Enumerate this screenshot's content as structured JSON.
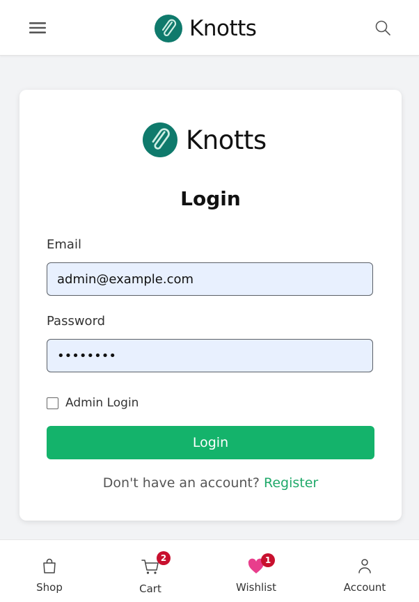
{
  "header": {
    "brand_name": "Knotts",
    "menu_icon": "hamburger-menu-icon",
    "search_icon": "search-icon"
  },
  "login_card": {
    "brand_name": "Knotts",
    "title": "Login",
    "email": {
      "label": "Email",
      "value": "admin@example.com"
    },
    "password": {
      "label": "Password",
      "value": "••••••••"
    },
    "admin_checkbox": {
      "label": "Admin Login",
      "checked": false
    },
    "submit_label": "Login",
    "register_prompt": "Don't have an account?",
    "register_link": "Register"
  },
  "bottom_nav": {
    "items": [
      {
        "label": "Shop",
        "icon": "shopping-bag-icon"
      },
      {
        "label": "Cart",
        "icon": "cart-icon",
        "badge": "2"
      },
      {
        "label": "Wishlist",
        "icon": "heart-icon",
        "badge": "1"
      },
      {
        "label": "Account",
        "icon": "user-icon"
      }
    ]
  },
  "colors": {
    "brand_green": "#14b36b",
    "logo_teal": "#0f7a6c",
    "link_green": "#20a96a",
    "badge_red": "#c8102e",
    "heart_pink": "#e83e8c",
    "input_bg": "#e8f0fe"
  }
}
